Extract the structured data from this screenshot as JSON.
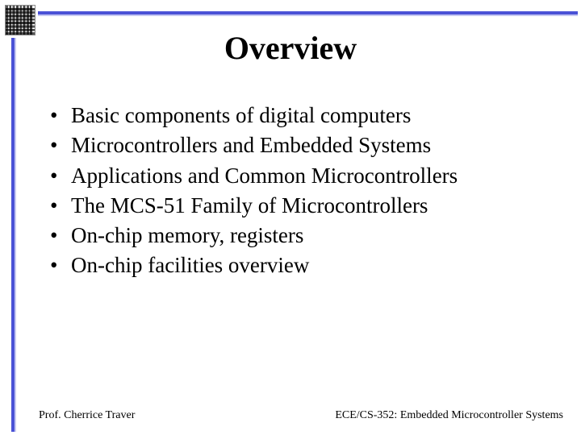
{
  "title": "Overview",
  "bullets": [
    "Basic components of digital computers",
    "Microcontrollers and Embedded Systems",
    "Applications and Common Microcontrollers",
    "The MCS-51 Family of Microcontrollers",
    "On-chip memory, registers",
    "On-chip facilities overview"
  ],
  "footer": {
    "left": "Prof. Cherrice Traver",
    "right": "ECE/CS-352: Embedded Microcontroller Systems"
  }
}
